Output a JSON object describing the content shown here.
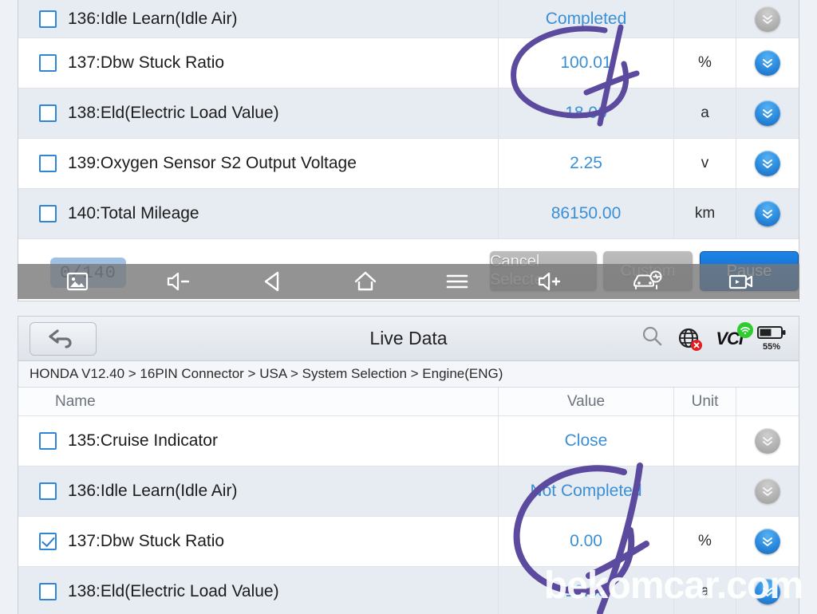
{
  "top_panel": {
    "rows": [
      {
        "checked": false,
        "name": "136:Idle Learn(Idle Air)",
        "value": "Completed",
        "unit": "",
        "action": "expand-chevron-icon",
        "enabled": false
      },
      {
        "checked": false,
        "name": "137:Dbw Stuck Ratio",
        "value": "100.01",
        "unit": "%",
        "action": "expand-chevron-icon",
        "enabled": true
      },
      {
        "checked": false,
        "name": "138:Eld(Electric Load Value)",
        "value": "18.00",
        "unit": "a",
        "action": "expand-chevron-icon",
        "enabled": true
      },
      {
        "checked": false,
        "name": "139:Oxygen Sensor S2 Output Voltage",
        "value": "2.25",
        "unit": "v",
        "action": "expand-chevron-icon",
        "enabled": true
      },
      {
        "checked": false,
        "name": "140:Total Mileage",
        "value": "86150.00",
        "unit": "km",
        "action": "expand-chevron-icon",
        "enabled": true
      }
    ],
    "toolbar": {
      "counter": "0/140",
      "cancel_selected_label": "Cancel Selected",
      "custom_label": "Custom",
      "pause_label": "Pause"
    }
  },
  "navbar": {
    "icons": [
      "gallery-icon",
      "volume-down-icon",
      "back-icon",
      "home-icon",
      "menu-icon",
      "volume-up-icon",
      "car-diagnostics-icon",
      "screen-record-icon"
    ]
  },
  "bottom_panel": {
    "header": {
      "back_icon": "back-arrow-icon",
      "title": "Live Data",
      "search_icon": "search-icon",
      "network_icon": "globe-offline-icon",
      "vci_label": "VCI",
      "vci_signal_icon": "wifi-icon",
      "battery_icon": "battery-icon",
      "battery_percent": "55%"
    },
    "breadcrumb": "HONDA V12.40 > 16PIN Connector  > USA  > System Selection  > Engine(ENG)",
    "columns": {
      "name": "Name",
      "value": "Value",
      "unit": "Unit"
    },
    "rows": [
      {
        "checked": false,
        "name": "135:Cruise Indicator",
        "value": "Close",
        "unit": "",
        "action": "expand-chevron-icon",
        "enabled": false
      },
      {
        "checked": false,
        "name": "136:Idle Learn(Idle Air)",
        "value": "Not Completed",
        "unit": "",
        "action": "expand-chevron-icon",
        "enabled": false
      },
      {
        "checked": true,
        "name": "137:Dbw Stuck Ratio",
        "value": "0.00",
        "unit": "%",
        "action": "expand-chevron-icon",
        "enabled": true
      },
      {
        "checked": false,
        "name": "138:Eld(Electric Load Value)",
        "value": "13.00",
        "unit": "a",
        "action": "expand-chevron-icon",
        "enabled": true
      }
    ]
  },
  "watermark": {
    "text": "bekomcar.com"
  },
  "colors": {
    "value_blue": "#3a8fd6",
    "accent_blue": "#2f86d8",
    "pen_purple": "#5b4a9e",
    "pause_blue": "#1d84e8",
    "alt_row": "#e7ecf2"
  }
}
